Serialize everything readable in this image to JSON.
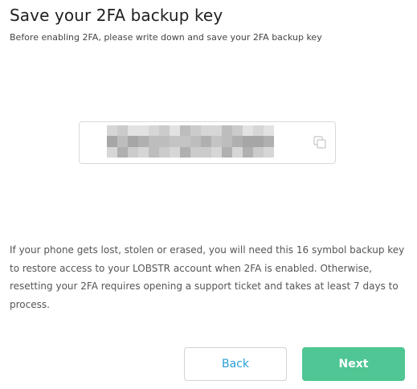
{
  "dialog": {
    "title": "Save your 2FA backup key",
    "subtitle": "Before enabling 2FA, please write down and save your 2FA backup key"
  },
  "backup_key": {
    "copy_icon": "copy-icon"
  },
  "info_text": "If your phone gets lost, stolen or erased, you will need this 16 symbol backup key to restore access to your LOBSTR account when 2FA is enabled. Otherwise, resetting your 2FA requires opening a support ticket and takes at least 7 days to process.",
  "buttons": {
    "back_label": "Back",
    "next_label": "Next"
  },
  "colors": {
    "accent_link": "#2a9fd6",
    "primary_button": "#4fc693",
    "border": "#d9d9d9"
  }
}
